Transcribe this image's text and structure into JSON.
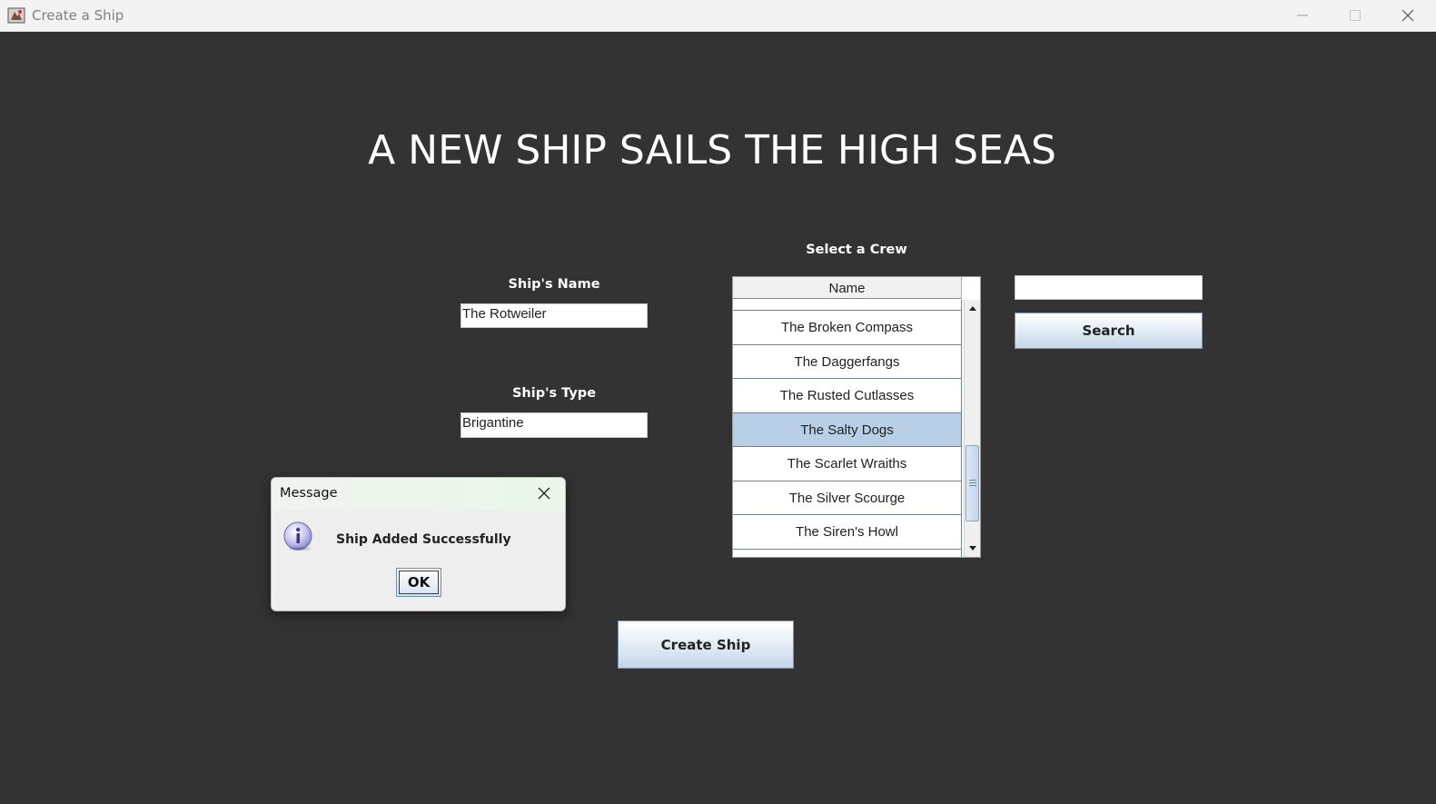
{
  "window": {
    "title": "Create a Ship"
  },
  "main": {
    "heading": "A NEW SHIP SAILS THE HIGH SEAS",
    "ship_name_label": "Ship's Name",
    "ship_name_value": "The Rotweiler",
    "ship_type_label": "Ship's Type",
    "ship_type_value": "Brigantine",
    "crew_label": "Select a Crew",
    "create_button": "Create Ship"
  },
  "crew_table": {
    "column_header": "Name",
    "rows": [
      {
        "name": "The Broken Compass",
        "selected": false
      },
      {
        "name": "The Daggerfangs",
        "selected": false
      },
      {
        "name": "The Rusted Cutlasses",
        "selected": false
      },
      {
        "name": "The Salty Dogs",
        "selected": true
      },
      {
        "name": "The Scarlet Wraiths",
        "selected": false
      },
      {
        "name": "The Silver Scourge",
        "selected": false
      },
      {
        "name": "The Siren's Howl",
        "selected": false
      }
    ]
  },
  "search": {
    "value": "",
    "button_label": "Search"
  },
  "dialog": {
    "title": "Message",
    "message": "Ship Added Successfully",
    "ok_label": "OK",
    "icon": "info-icon"
  },
  "colors": {
    "background": "#333333",
    "selected_row": "#b8cfe5",
    "button_border": "#7a96b8"
  }
}
